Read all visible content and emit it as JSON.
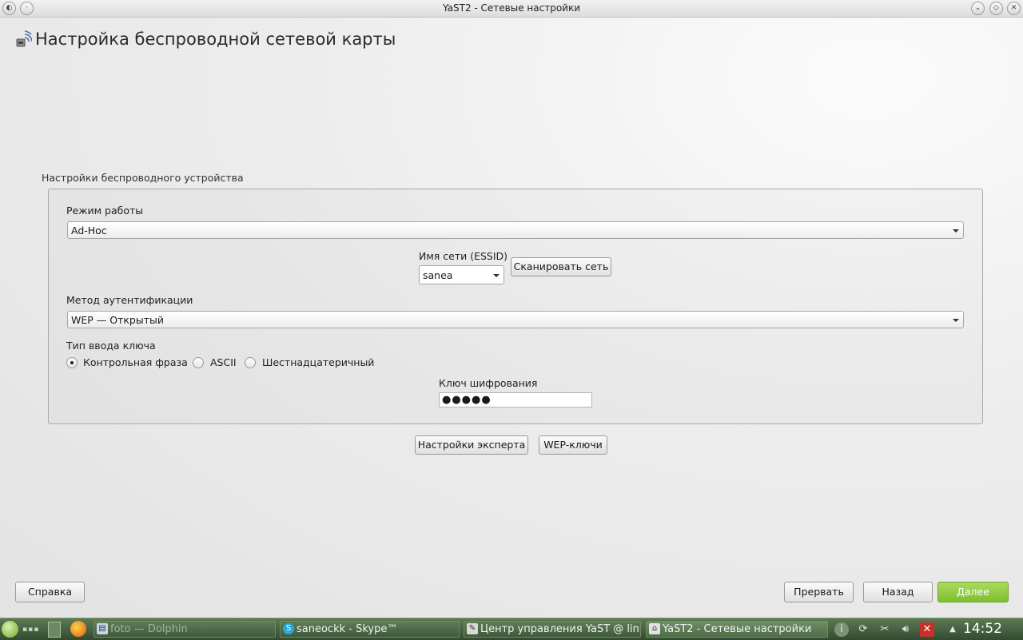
{
  "window": {
    "title": "YaST2 - Сетевые настройки"
  },
  "page": {
    "title": "Настройка беспроводной сетевой карты"
  },
  "group": {
    "label": "Настройки беспроводного устройства"
  },
  "mode": {
    "label": "Режим работы",
    "value": "Ad-Hoc"
  },
  "essid": {
    "label": "Имя сети (ESSID)",
    "value": "sanea",
    "scan_label": "Сканировать сеть"
  },
  "auth": {
    "label": "Метод аутентификации",
    "value": "WEP — Открытый"
  },
  "key_type": {
    "label": "Тип ввода ключа",
    "options": [
      "Контрольная фраза",
      "ASCII",
      "Шестнадцатеричный"
    ],
    "selected": "Контрольная фраза"
  },
  "encryption_key": {
    "label": "Ключ шифрования",
    "masked_value": "●●●●●"
  },
  "actions": {
    "expert_label": "Настройки эксперта",
    "wep_keys_label": "WEP-ключи"
  },
  "footer": {
    "help_label": "Справка",
    "abort_label": "Прервать",
    "back_label": "Назад",
    "next_label": "Далее"
  },
  "taskbar": {
    "tasks": [
      {
        "label": "foto — Dolphin",
        "icon": "folder-icon",
        "state": "inactive"
      },
      {
        "label": "saneockk - Skype™",
        "icon": "skype-icon",
        "state": "normal"
      },
      {
        "label": "Центр управления YaST @ linux",
        "icon": "yast-icon",
        "state": "normal"
      },
      {
        "label": "YaST2 - Сетевые настройки",
        "icon": "network-icon",
        "state": "active"
      }
    ],
    "clock": "14:52"
  },
  "colors": {
    "accent_next": "#8fcb3b",
    "taskbar": "#3e5a3a"
  }
}
